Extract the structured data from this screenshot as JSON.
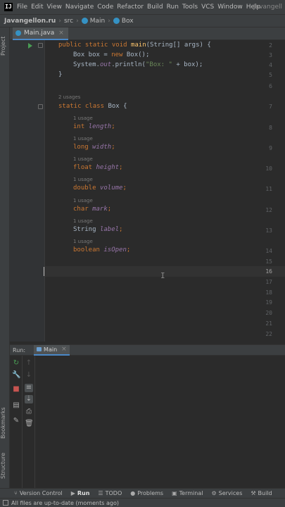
{
  "menubar": {
    "items": [
      "File",
      "Edit",
      "View",
      "Navigate",
      "Code",
      "Refactor",
      "Build",
      "Run",
      "Tools",
      "VCS",
      "Window",
      "Help"
    ],
    "project_title": "Javangell"
  },
  "breadcrumb": {
    "project": "Javangellon.ru",
    "src": "src",
    "main": "Main",
    "box": "Box"
  },
  "left_strip": {
    "project": "Project",
    "bookmarks": "Bookmarks",
    "structure": "Structure"
  },
  "editor_tab": {
    "label": "Main.java"
  },
  "editor": {
    "line_numbers": [
      "2",
      "3",
      "4",
      "5",
      "6",
      "7",
      "8",
      "9",
      "10",
      "11",
      "12",
      "13",
      "14",
      "15",
      "16",
      "17",
      "18",
      "19",
      "20",
      "21",
      "22"
    ],
    "current_line": "16",
    "hints": {
      "class_usages": "2 usages",
      "field_usage": "1 usage"
    },
    "code": {
      "main_sig": [
        "public static void ",
        "main",
        "(String[] args) {"
      ],
      "box_new": [
        "Box box = ",
        "new ",
        "Box();"
      ],
      "println": [
        "System.",
        "out",
        ".println(",
        "\"Box: \"",
        " + box);"
      ],
      "close_main": "}",
      "class_decl": [
        "static class ",
        "Box {"
      ],
      "f_length": [
        "int ",
        "length",
        ";"
      ],
      "f_width": [
        "long ",
        "width",
        ";"
      ],
      "f_height": [
        "float ",
        "height",
        ";"
      ],
      "f_volume": [
        "double ",
        "volume",
        ";"
      ],
      "f_mark": [
        "char ",
        "mark",
        ";"
      ],
      "f_label": [
        "String ",
        "label",
        ";"
      ],
      "f_isopen": [
        "boolean ",
        "isOpen",
        ";"
      ]
    }
  },
  "run_panel": {
    "label": "Run:",
    "tab": "Main"
  },
  "tool_windows": {
    "version_control": "Version Control",
    "run": "Run",
    "todo": "TODO",
    "problems": "Problems",
    "terminal": "Terminal",
    "services": "Services",
    "build": "Build"
  },
  "status": {
    "text": "All files are up-to-date (moments ago)"
  },
  "colors": {
    "keyword": "#cc7832",
    "function": "#ffc66d",
    "string": "#6a8759",
    "field": "#9876aa",
    "accent": "#4a88c7"
  }
}
